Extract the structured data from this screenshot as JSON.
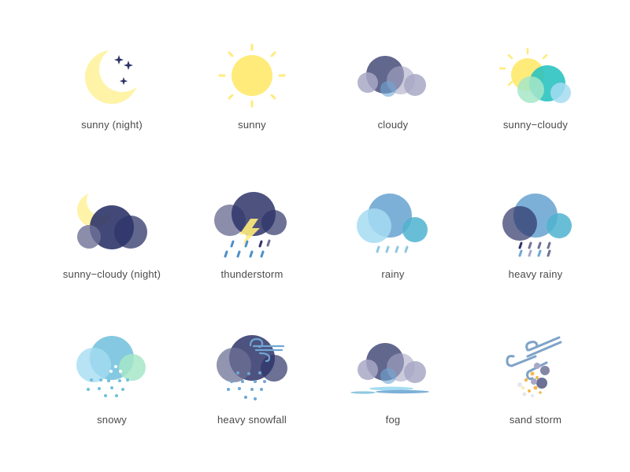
{
  "colors": {
    "yellow": "#FFEB7A",
    "pale_yellow": "#FFF3A8",
    "navy": "#2E3468",
    "slate": "#6E7196",
    "lavender": "#A8A8C6",
    "sky": "#6FA7D3",
    "light_sky": "#A5DCF2",
    "teal": "#2BC3C1",
    "mint": "#A6E6C8",
    "label": "#4a4a4a"
  },
  "icons": [
    {
      "label": "sunny (night)",
      "icon": "moon-stars-icon"
    },
    {
      "label": "sunny",
      "icon": "sun-icon"
    },
    {
      "label": "cloudy",
      "icon": "cloud-icon"
    },
    {
      "label": "sunny−cloudy",
      "icon": "sun-cloud-icon"
    },
    {
      "label": "sunny−cloudy (night)",
      "icon": "moon-cloud-icon"
    },
    {
      "label": "thunderstorm",
      "icon": "thunderstorm-icon"
    },
    {
      "label": "rainy",
      "icon": "rain-icon"
    },
    {
      "label": "heavy rainy",
      "icon": "heavy-rain-icon"
    },
    {
      "label": "snowy",
      "icon": "snow-icon"
    },
    {
      "label": "heavy snowfall",
      "icon": "heavy-snow-icon"
    },
    {
      "label": "fog",
      "icon": "fog-icon"
    },
    {
      "label": "sand storm",
      "icon": "sand-storm-icon"
    }
  ]
}
